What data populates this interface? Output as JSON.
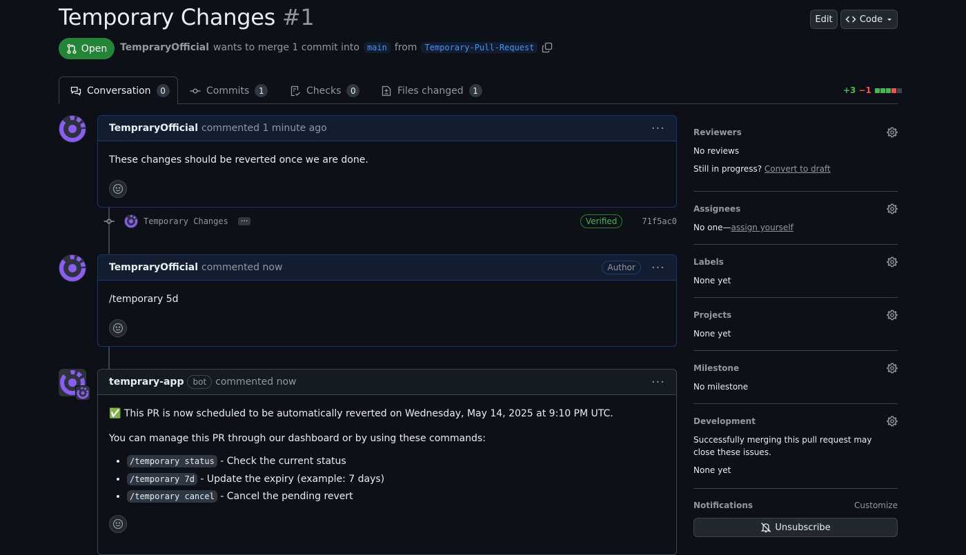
{
  "pr": {
    "title": "Temporary Changes",
    "number": "#1",
    "state": "Open",
    "author": "TempraryOfficial",
    "merge_text": "wants to merge 1 commit into",
    "base": "main",
    "from_text": "from",
    "head": "Temporary-Pull-Request"
  },
  "header_buttons": {
    "edit": "Edit",
    "code": "Code"
  },
  "tabs": [
    {
      "label": "Conversation",
      "count": "0"
    },
    {
      "label": "Commits",
      "count": "1"
    },
    {
      "label": "Checks",
      "count": "0"
    },
    {
      "label": "Files changed",
      "count": "1"
    }
  ],
  "diffstat": {
    "additions": "+3",
    "deletions": "−1"
  },
  "comments": [
    {
      "author": "TempraryOfficial",
      "time": "commented 1 minute ago",
      "body": "These changes should be reverted once we are done."
    },
    {
      "author": "TempraryOfficial",
      "time": "commented now",
      "badge": "Author",
      "body": "/temporary 5d"
    },
    {
      "author": "temprary-app",
      "bot": "bot",
      "time": "commented now",
      "line1": "✅ This PR is now scheduled to be automatically reverted on Wednesday, May 14, 2025 at 9:10 PM UTC.",
      "line2": "You can manage this PR through our dashboard or by using these commands:",
      "commands": [
        {
          "code": "/temporary status",
          "desc": "- Check the current status"
        },
        {
          "code": "/temporary 7d",
          "desc": "- Update the expiry (example: 7 days)"
        },
        {
          "code": "/temporary cancel",
          "desc": "- Cancel the pending revert"
        }
      ]
    }
  ],
  "commit": {
    "message": "Temporary Changes",
    "verified": "Verified",
    "sha": "71f5ac0",
    "more": "···"
  },
  "sidebar": {
    "reviewers": {
      "title": "Reviewers",
      "value": "No reviews",
      "progress_text": "Still in progress?",
      "progress_link": "Convert to draft"
    },
    "assignees": {
      "title": "Assignees",
      "value": "No one—",
      "link": "assign yourself"
    },
    "labels": {
      "title": "Labels",
      "value": "None yet"
    },
    "projects": {
      "title": "Projects",
      "value": "None yet"
    },
    "milestone": {
      "title": "Milestone",
      "value": "No milestone"
    },
    "development": {
      "title": "Development",
      "value": "Successfully merging this pull request may close these issues.",
      "value2": "None yet"
    },
    "notifications": {
      "title": "Notifications",
      "customize": "Customize",
      "unsubscribe": "Unsubscribe"
    }
  },
  "colors": {
    "accent": "#238636",
    "link": "#4493f8",
    "avatar": "#8b5cf6"
  }
}
